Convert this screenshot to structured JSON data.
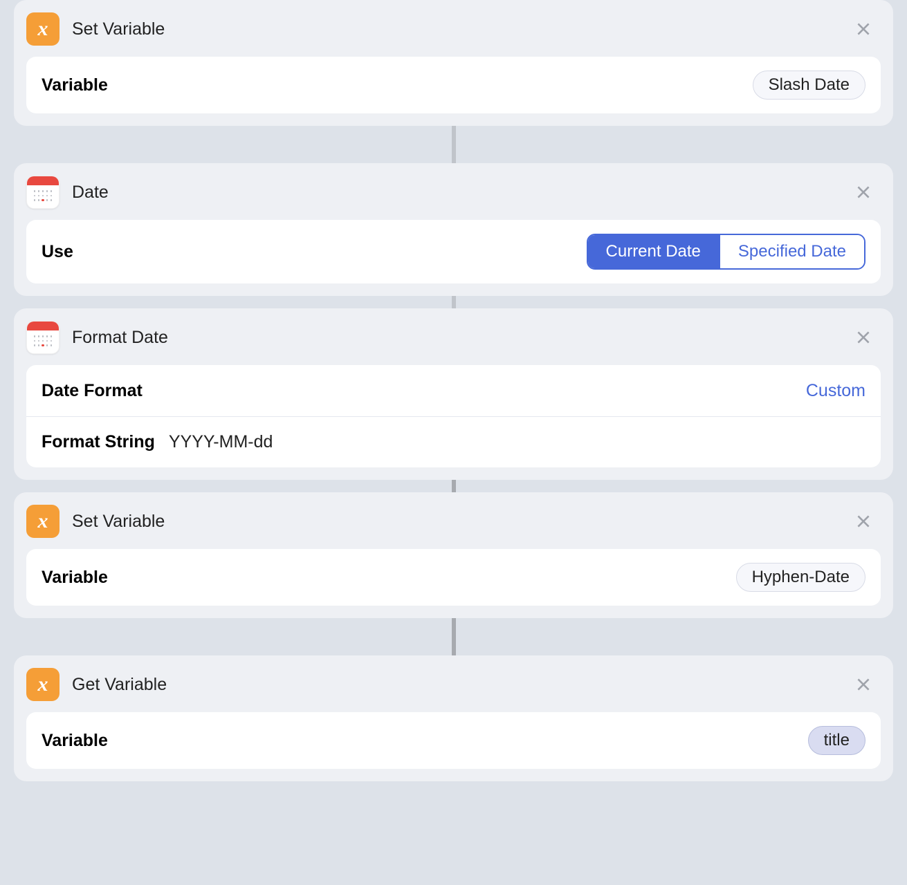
{
  "actions": [
    {
      "id": "set-var-1",
      "title": "Set Variable",
      "icon": "variable",
      "rows": [
        {
          "type": "pill",
          "label": "Variable",
          "value": "Slash Date",
          "selected": false
        }
      ]
    },
    {
      "id": "date",
      "title": "Date",
      "icon": "calendar",
      "gap_before": true,
      "rows": [
        {
          "type": "segmented",
          "label": "Use",
          "options": [
            "Current Date",
            "Specified Date"
          ],
          "active_index": 0
        }
      ]
    },
    {
      "id": "format-date",
      "title": "Format Date",
      "icon": "calendar",
      "rows": [
        {
          "type": "link",
          "label": "Date Format",
          "value": "Custom"
        },
        {
          "type": "text",
          "label": "Format String",
          "value": "YYYY-MM-dd"
        }
      ]
    },
    {
      "id": "set-var-2",
      "title": "Set Variable",
      "icon": "variable",
      "rows": [
        {
          "type": "pill",
          "label": "Variable",
          "value": "Hyphen-Date",
          "selected": false
        }
      ]
    },
    {
      "id": "get-var",
      "title": "Get Variable",
      "icon": "variable",
      "gap_before": true,
      "rows": [
        {
          "type": "pill",
          "label": "Variable",
          "value": "title",
          "selected": true
        }
      ]
    }
  ]
}
